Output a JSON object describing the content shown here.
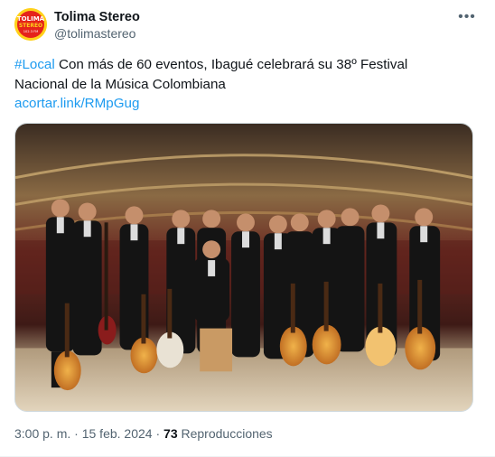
{
  "account": {
    "name": "Tolima Stereo",
    "handle": "@tolimastereo",
    "avatar_text": "TOLIMA STEREO",
    "avatar_freq": "102.3 FM"
  },
  "post": {
    "hashtag": "#Local",
    "text": " Con más de 60 eventos, Ibagué celebrará su 38º Festival Nacional de la Música Colombiana",
    "link": "acortar.link/RMpGug",
    "more_icon": "more-horizontal-icon"
  },
  "media": {
    "kind": "photo"
  },
  "footer": {
    "time": "3:00 p. m.",
    "sep1": " · ",
    "date": "15 feb. 2024",
    "sep2": " · ",
    "views_count": "73",
    "views_label": " Reproducciones"
  }
}
